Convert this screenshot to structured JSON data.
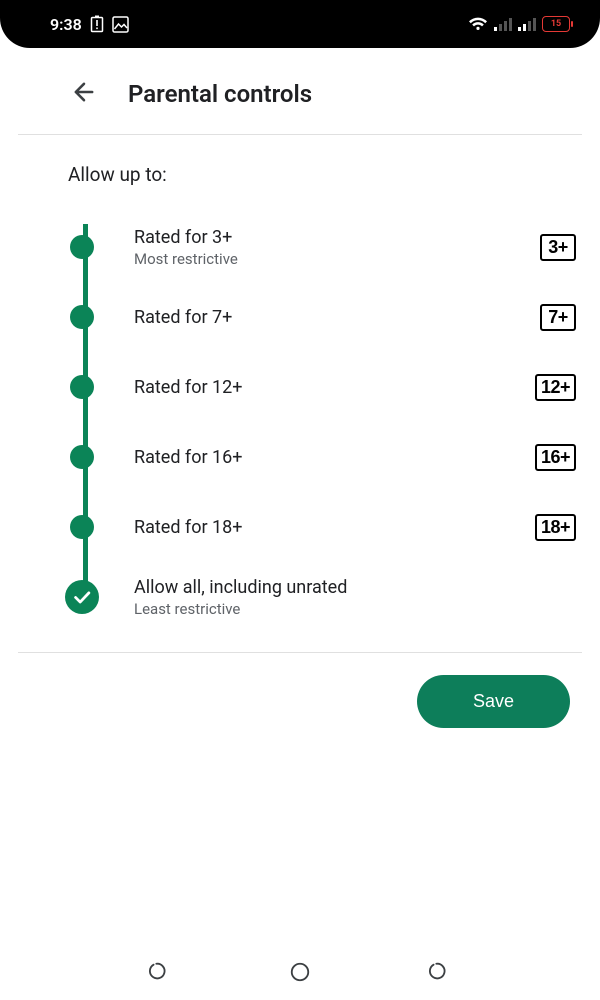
{
  "status": {
    "time": "9:38",
    "battery": "15"
  },
  "header": {
    "title": "Parental controls"
  },
  "subhead": "Allow up to:",
  "options": [
    {
      "label": "Rated for 3+",
      "sub": "Most restrictive",
      "badge": "3+"
    },
    {
      "label": "Rated for 7+",
      "sub": "",
      "badge": "7+"
    },
    {
      "label": "Rated for 12+",
      "sub": "",
      "badge": "12+"
    },
    {
      "label": "Rated for 16+",
      "sub": "",
      "badge": "16+"
    },
    {
      "label": "Rated for 18+",
      "sub": "",
      "badge": "18+"
    },
    {
      "label": "Allow all, including unrated",
      "sub": "Least restrictive",
      "badge": ""
    }
  ],
  "buttons": {
    "save": "Save"
  }
}
